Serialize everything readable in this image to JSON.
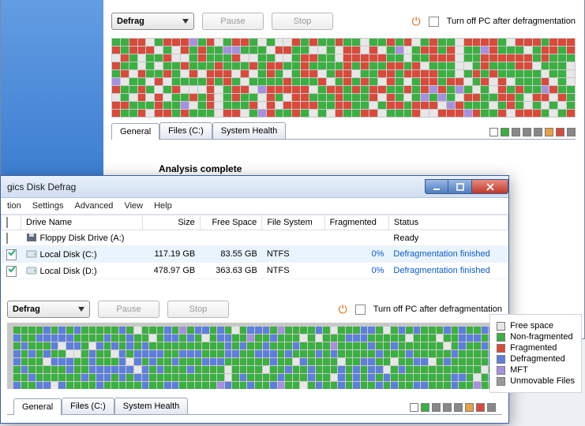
{
  "upper": {
    "toolbar": {
      "defrag_label": "Defrag",
      "pause_label": "Pause",
      "stop_label": "Stop",
      "turnoff_label": "Turn off PC after defragmentation"
    },
    "tabs": {
      "general": "General",
      "files": "Files (C:)",
      "health": "System Health"
    },
    "analysis": "Analysis complete",
    "legend_colors": [
      "#ffffff",
      "#3ab040",
      "#888888",
      "#888888",
      "#888888",
      "#e7a23f",
      "#d94a3a",
      "#888888"
    ]
  },
  "fg": {
    "title": "gics Disk Defrag",
    "menu": [
      "tion",
      "Settings",
      "Advanced",
      "View",
      "Help"
    ],
    "columns": [
      "Drive Name",
      "Size",
      "Free Space",
      "File System",
      "Fragmented",
      "Status"
    ],
    "rows": [
      {
        "chk": false,
        "icon": "floppy",
        "name": "Floppy Disk Drive (A:)",
        "size": "",
        "free": "",
        "fs": "",
        "frag": "",
        "status": "Ready",
        "link": false
      },
      {
        "chk": true,
        "icon": "hdd",
        "name": "Local Disk (C:)",
        "size": "117.19 GB",
        "free": "83.55 GB",
        "fs": "NTFS",
        "frag": "0%",
        "status": "Defragmentation finished",
        "link": true,
        "sel": true
      },
      {
        "chk": true,
        "icon": "hdd",
        "name": "Local Disk (D:)",
        "size": "478.97 GB",
        "free": "363.63 GB",
        "fs": "NTFS",
        "frag": "0%",
        "status": "Defragmentation finished",
        "link": true
      }
    ],
    "toolbar": {
      "defrag_label": "Defrag",
      "pause_label": "Pause",
      "stop_label": "Stop",
      "turnoff_label": "Turn off PC after defragmentation"
    },
    "tabs": {
      "general": "General",
      "files": "Files (C:)",
      "health": "System Health"
    }
  },
  "legend": [
    {
      "c": "#e7e7e7",
      "t": "Free space"
    },
    {
      "c": "#3ab040",
      "t": "Non-fragmented"
    },
    {
      "c": "#d94a3a",
      "t": "Fragmented"
    },
    {
      "c": "#5d7fdc",
      "t": "Defragmented"
    },
    {
      "c": "#a890e0",
      "t": "MFT"
    },
    {
      "c": "#9a9a9a",
      "t": "Unmovable Files"
    }
  ],
  "maps": {
    "bg_cols": 54,
    "bg_rows": 10,
    "fg_cols": 64,
    "fg_rows": 8
  }
}
